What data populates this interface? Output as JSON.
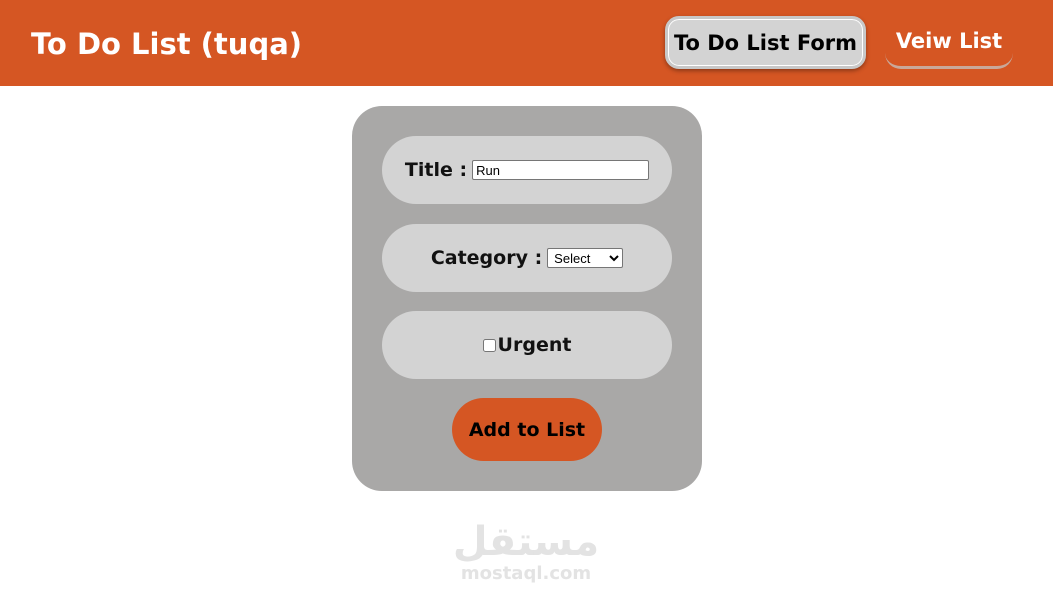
{
  "header": {
    "title": "To Do List (tuqa)",
    "nav": {
      "form_label": "To Do List Form",
      "view_label": "Veiw List"
    }
  },
  "form": {
    "title_label": "Title :",
    "title_value": "Run",
    "category_label": "Category :",
    "category_selected": "Select",
    "urgent_label": "Urgent",
    "urgent_checked": false,
    "submit_label": "Add to List"
  },
  "watermark": {
    "arabic": "مستقل",
    "latin": "mostaql.com"
  },
  "colors": {
    "brand": "#d55623",
    "card": "#a9a8a7",
    "pill": "#d3d3d3"
  }
}
